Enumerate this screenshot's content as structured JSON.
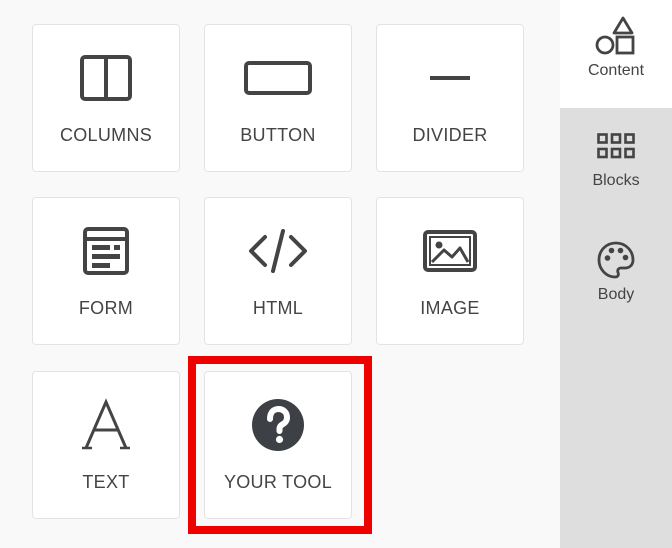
{
  "tools": [
    {
      "name": "columns",
      "label": "COLUMNS",
      "icon": "columns-icon"
    },
    {
      "name": "button",
      "label": "BUTTON",
      "icon": "button-icon"
    },
    {
      "name": "divider",
      "label": "DIVIDER",
      "icon": "divider-icon"
    },
    {
      "name": "form",
      "label": "FORM",
      "icon": "form-icon"
    },
    {
      "name": "html",
      "label": "HTML",
      "icon": "code-icon"
    },
    {
      "name": "image",
      "label": "IMAGE",
      "icon": "image-icon"
    },
    {
      "name": "text",
      "label": "TEXT",
      "icon": "text-icon"
    },
    {
      "name": "your-tool",
      "label": "YOUR TOOL",
      "icon": "question-circle-icon"
    }
  ],
  "highlight_color": "#ee0000",
  "sidebar": {
    "tabs": [
      {
        "label": "Content",
        "icon": "shapes-icon",
        "active": true
      },
      {
        "label": "Blocks",
        "icon": "grid-icon",
        "active": false
      },
      {
        "label": "Body",
        "icon": "palette-icon",
        "active": false
      }
    ]
  }
}
